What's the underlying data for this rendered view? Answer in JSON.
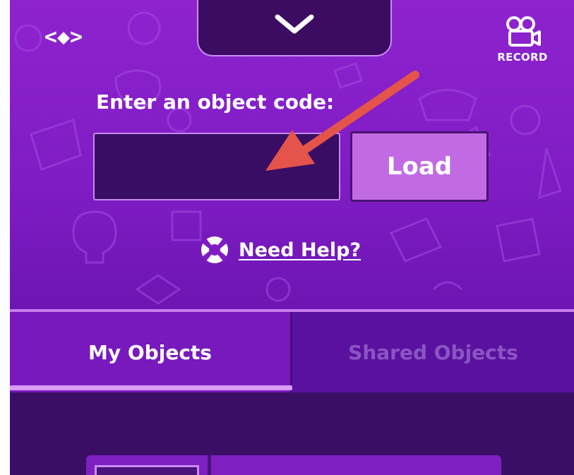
{
  "header": {
    "nav_icon": "code-brackets-icon",
    "nav_glyph": "<◆>",
    "collapse_icon": "chevron-down-icon",
    "record_icon": "video-camera-icon",
    "record_label": "RECORD"
  },
  "object_code": {
    "label": "Enter an object code:",
    "input_value": "",
    "load_label": "Load"
  },
  "help": {
    "icon": "lifebuoy-icon",
    "label": "Need Help?"
  },
  "tabs": [
    {
      "label": "My Objects",
      "active": true
    },
    {
      "label": "Shared Objects",
      "active": false
    }
  ],
  "annotation": {
    "icon": "red-arrow-icon",
    "color": "#e4544a"
  },
  "colors": {
    "background": "#8e23cf",
    "input_fill": "#3a0d65",
    "button_fill": "#c26ae4",
    "accent_line": "#d99bf6"
  }
}
